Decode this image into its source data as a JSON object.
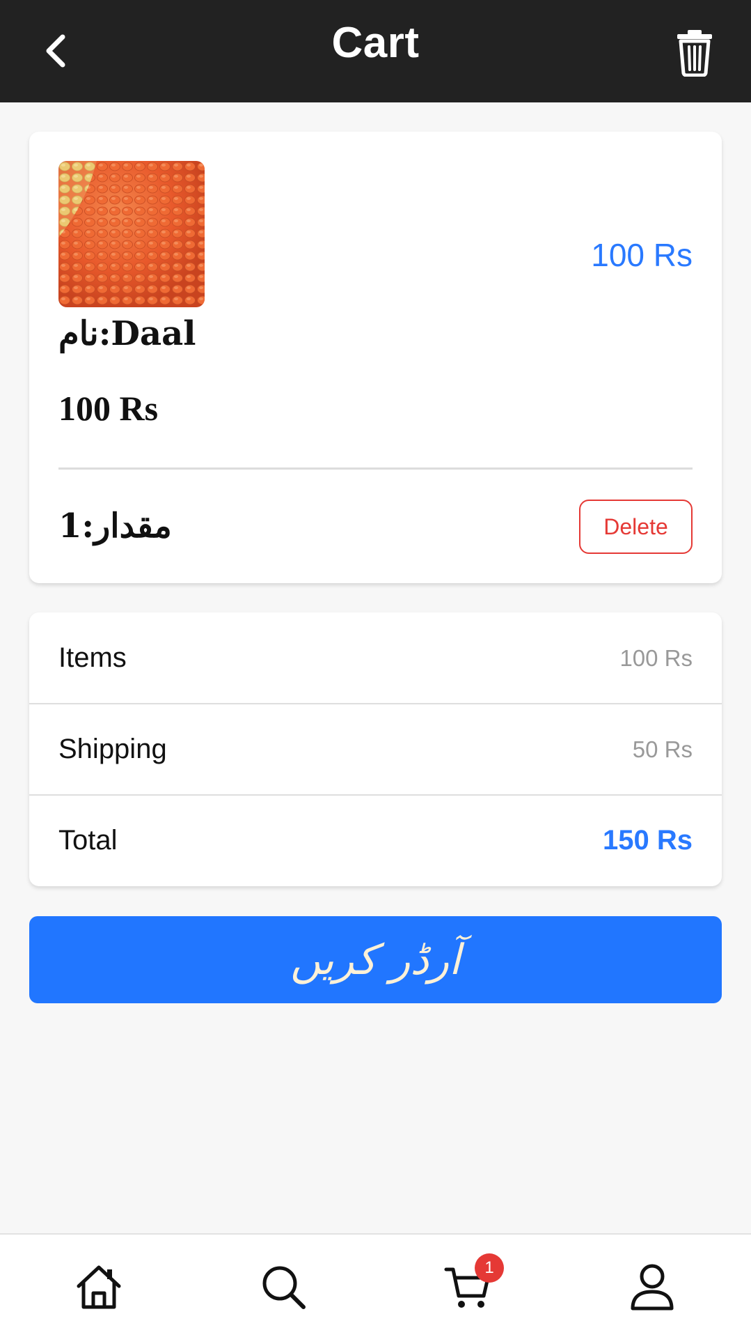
{
  "header": {
    "title": "Cart"
  },
  "product": {
    "image_alt": "Daal",
    "price_right": "100 Rs",
    "name_line": "نام:Daal",
    "price_line": "100 Rs",
    "qty_line": "مقدار:1",
    "delete_label": "Delete"
  },
  "summary": {
    "rows": [
      {
        "label": "Items",
        "value": "100 Rs"
      },
      {
        "label": "Shipping",
        "value": "50 Rs"
      },
      {
        "label": "Total",
        "value": "150 Rs"
      }
    ]
  },
  "order_button": {
    "label": "آرڈر کریں"
  },
  "bottom_nav": {
    "items": [
      {
        "icon": "home-icon"
      },
      {
        "icon": "search-icon"
      },
      {
        "icon": "cart-icon"
      },
      {
        "icon": "profile-icon"
      }
    ],
    "cart_badge": "1"
  },
  "colors": {
    "header_bg": "#222222",
    "accent": "#2979ff",
    "danger": "#e53935",
    "order_button_bg": "#2176ff"
  }
}
